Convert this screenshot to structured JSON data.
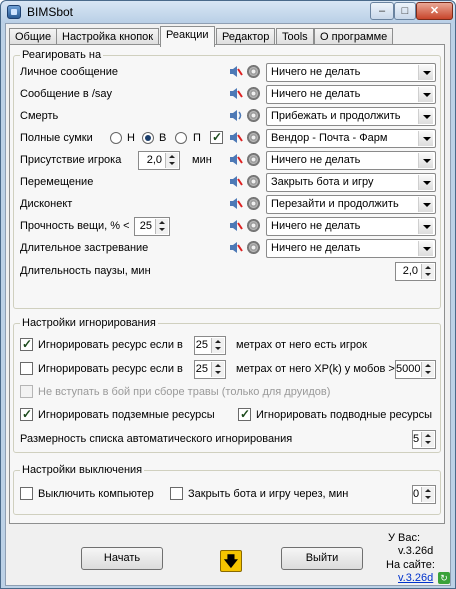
{
  "window": {
    "title": "BIMSbot"
  },
  "tabs": [
    {
      "label": "Общие"
    },
    {
      "label": "Настройка кнопок"
    },
    {
      "label": "Реакции"
    },
    {
      "label": "Редактор"
    },
    {
      "label": "Tools"
    },
    {
      "label": "О программе"
    }
  ],
  "react": {
    "title": "Реагировать на",
    "rows": [
      {
        "label": "Личное сообщение",
        "action": "Ничего не делать"
      },
      {
        "label": "Сообщение в /say",
        "action": "Ничего не делать"
      },
      {
        "label": "Смерть",
        "action": "Прибежать и продолжить"
      },
      {
        "label": "Полные сумки",
        "action": "Вендор - Почта - Фарм"
      },
      {
        "label": "Присутствие игрока",
        "action": "Ничего не делать"
      },
      {
        "label": "Перемещение",
        "action": "Закрыть бота и игру"
      },
      {
        "label": "Дисконект",
        "action": "Перезайти и продолжить"
      },
      {
        "label": "Прочность вещи, % <",
        "action": "Ничего не делать"
      },
      {
        "label": "Длительное застревание",
        "action": "Ничего не делать"
      }
    ],
    "bags_radios": [
      "Н",
      "В",
      "П"
    ],
    "player_presence_value": "2,0",
    "player_presence_unit": "мин",
    "durability_value": "25",
    "pause_label": "Длительность паузы, мин",
    "pause_value": "2,0"
  },
  "ignore": {
    "title": "Настройки игнорирования",
    "row1_label": "Игнорировать ресурс если в",
    "row1_value": "25",
    "row1_suffix": "метрах от него есть игрок",
    "row2_label": "Игнорировать ресурс если в",
    "row2_value": "25",
    "row2_suffix": "метрах от него XP(k) у мобов >",
    "row2_xp_value": "5000",
    "row3_label": "Не вступать в бой при сборе травы (только для друидов)",
    "row4a_label": "Игнорировать подземные ресурсы",
    "row4b_label": "Игнорировать подводные ресурсы",
    "size_label": "Размерность списка автоматического игнорирования",
    "size_value": "5"
  },
  "shutdown": {
    "title": "Настройки выключения",
    "off_pc_label": "Выключить компьютер",
    "close_label": "Закрыть бота и игру через, мин",
    "close_value": "0"
  },
  "footer": {
    "start_label": "Начать",
    "down_arrow": "🡇",
    "exit_label": "Выйти",
    "you_have_label": "У Вас:",
    "you_have_version": "v.3.26d",
    "site_label": "На сайте:",
    "site_version": "v.3.26d"
  },
  "colors": {
    "accent_arrow": "#f5c400",
    "link": "#0033cc"
  }
}
